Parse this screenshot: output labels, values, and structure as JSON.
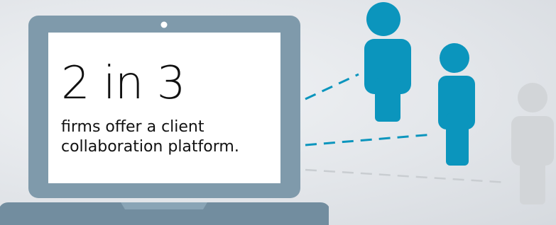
{
  "infographic": {
    "stat": "2 in 3",
    "caption_line1": "firms offer a client",
    "caption_line2": "collaboration platform."
  },
  "colors": {
    "laptop_frame": "#7f9aab",
    "laptop_base": "#728d9f",
    "screen": "#ffffff",
    "person_active": "#0b95bd",
    "person_inactive": "#d2d5d8",
    "link_active": "#0b95bd",
    "link_inactive": "#c9cdd1"
  },
  "icons": {
    "device": "laptop-icon",
    "people": [
      "person-icon",
      "person-icon",
      "person-icon"
    ]
  }
}
